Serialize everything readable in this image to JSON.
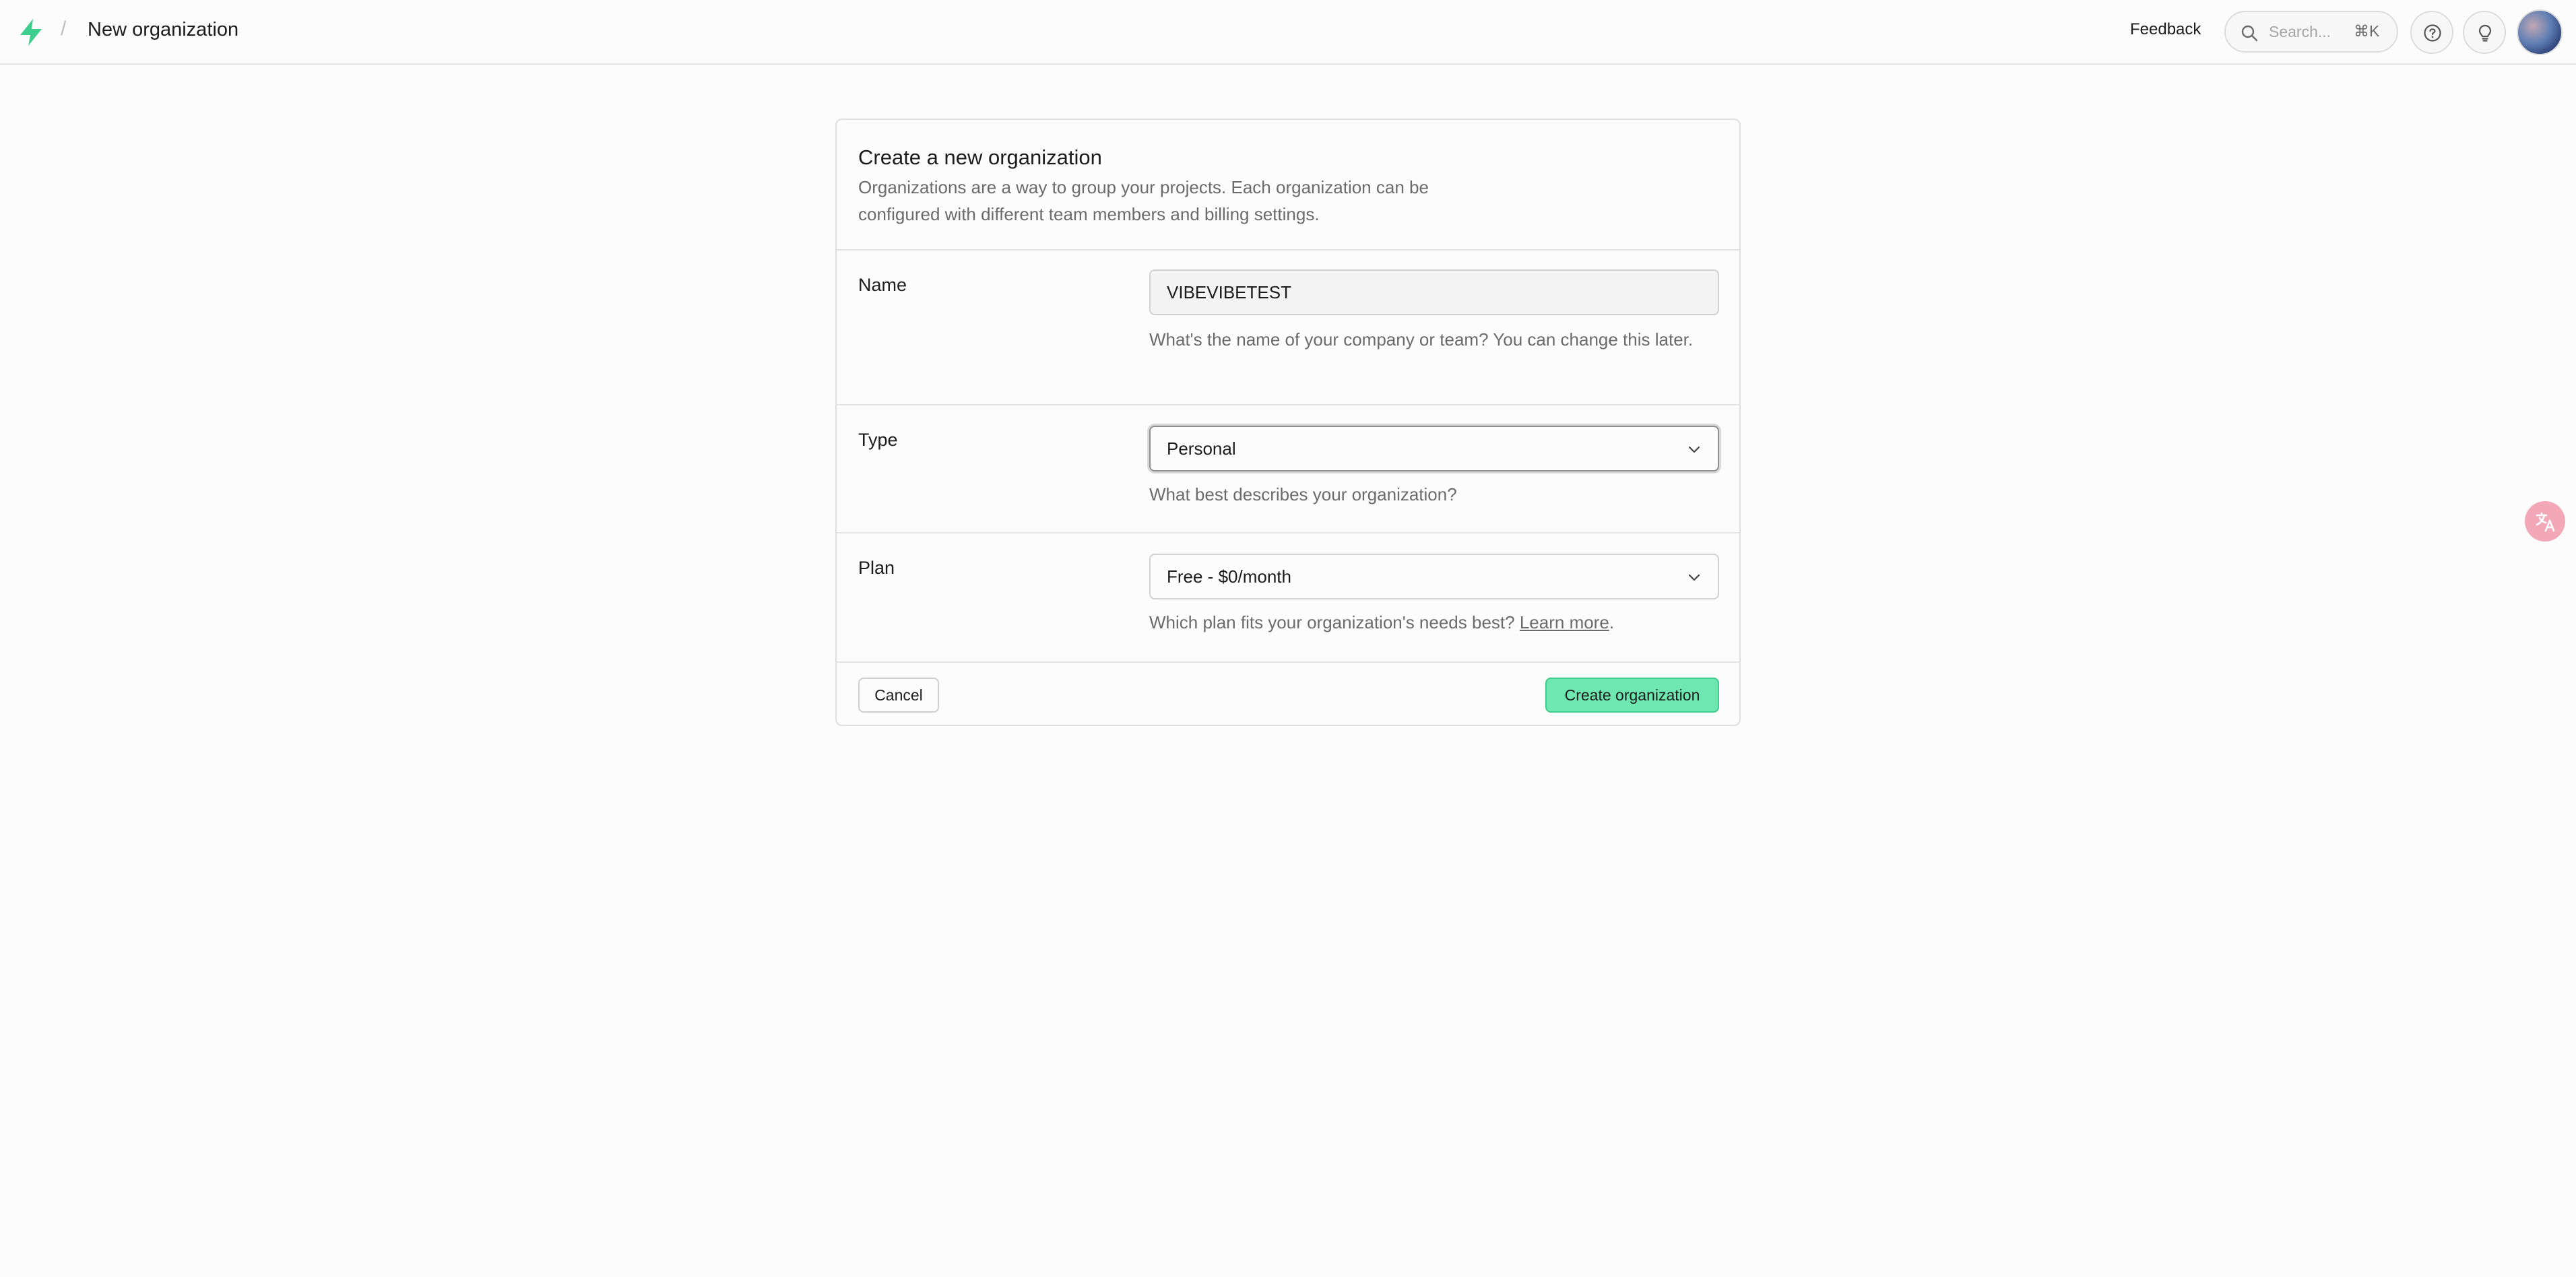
{
  "header": {
    "breadcrumb_separator": "/",
    "title": "New organization",
    "feedback_label": "Feedback",
    "search_placeholder": "Search...",
    "search_shortcut": "⌘K",
    "icons": [
      "bolt-logo-icon",
      "search-icon",
      "help-icon",
      "lightbulb-icon",
      "avatar"
    ]
  },
  "form": {
    "title": "Create a new organization",
    "description": "Organizations are a way to group your projects. Each organization can be configured with different team members and billing settings.",
    "name": {
      "label": "Name",
      "value": "VIBEVIBETEST",
      "help": "What's the name of your company or team? You can change this later."
    },
    "type": {
      "label": "Type",
      "value": "Personal",
      "help": "What best describes your organization?"
    },
    "plan": {
      "label": "Plan",
      "value": "Free - $0/month",
      "help_prefix": "Which plan fits your organization's needs best?",
      "help_link": "Learn more",
      "help_suffix": "."
    },
    "cancel_label": "Cancel",
    "submit_label": "Create organization"
  },
  "colors": {
    "brand_green": "#3ecf8e",
    "submit_bg": "#6ee7b0",
    "translate_badge": "#f3a8b8"
  }
}
